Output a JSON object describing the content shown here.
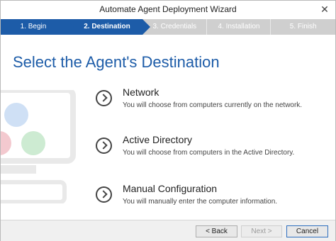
{
  "window": {
    "title": "Automate Agent Deployment Wizard",
    "close_glyph": "✕"
  },
  "steps": [
    {
      "label": "1. Begin",
      "state": "done"
    },
    {
      "label": "2. Destination",
      "state": "active"
    },
    {
      "label": "3. Credentials",
      "state": "pending"
    },
    {
      "label": "4. Installation",
      "state": "pending"
    },
    {
      "label": "5. Finish",
      "state": "pending"
    }
  ],
  "heading": "Select the Agent's Destination",
  "options": [
    {
      "title": "Network",
      "desc": "You will choose from computers currently on the network."
    },
    {
      "title": "Active Directory",
      "desc": "You will choose from computers in the Active Directory."
    },
    {
      "title": "Manual Configuration",
      "desc": "You will manually enter the computer information."
    }
  ],
  "footer": {
    "back": "< Back",
    "next": "Next >",
    "cancel": "Cancel"
  },
  "colors": {
    "accent": "#1d5ca8",
    "pending_step": "#cfcfcf",
    "circle_blue": "#cfe0f5",
    "circle_red": "#f3c9cf",
    "circle_green": "#cdebd2"
  },
  "icons": {
    "option_arrow": "chevron-right-circle-icon",
    "illustration": "computer-monitor-icon"
  }
}
